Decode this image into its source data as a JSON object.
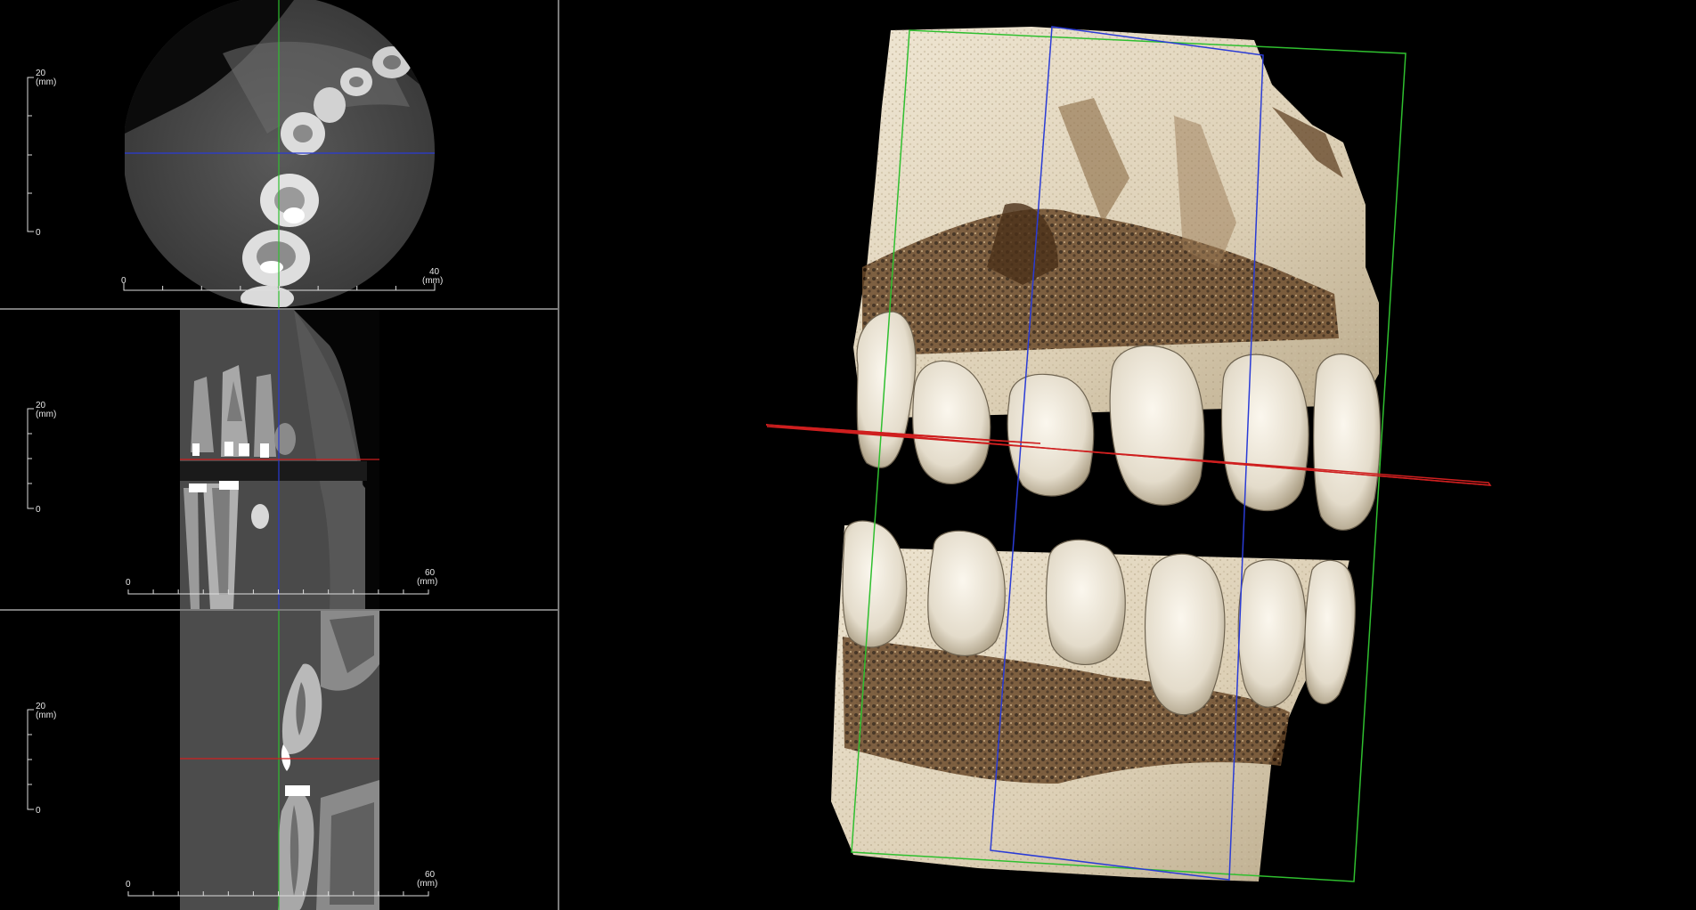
{
  "viewports": {
    "axial": {
      "vertical_scale": {
        "max_label": "20",
        "unit": "(mm)",
        "min_label": "0"
      },
      "horizontal_scale": {
        "min_label": "0",
        "max_label": "40",
        "unit": "(mm)"
      }
    },
    "coronal": {
      "vertical_scale": {
        "max_label": "20",
        "unit": "(mm)",
        "min_label": "0"
      },
      "horizontal_scale": {
        "min_label": "0",
        "max_label": "60",
        "unit": "(mm)"
      }
    },
    "sagittal": {
      "vertical_scale": {
        "max_label": "20",
        "unit": "(mm)",
        "min_label": "0"
      },
      "horizontal_scale": {
        "min_label": "0",
        "max_label": "60",
        "unit": "(mm)"
      }
    },
    "volume_3d": {
      "render": "volume rendering"
    }
  },
  "colors": {
    "background": "#000000",
    "divider": "#7a7a7a",
    "axial_line": "#2a3bd6",
    "coronal_line": "#cf1f1f",
    "sagittal_line": "#2fbf2f",
    "bone": "#e9dfcc",
    "tissue": "#6a4a2c"
  }
}
